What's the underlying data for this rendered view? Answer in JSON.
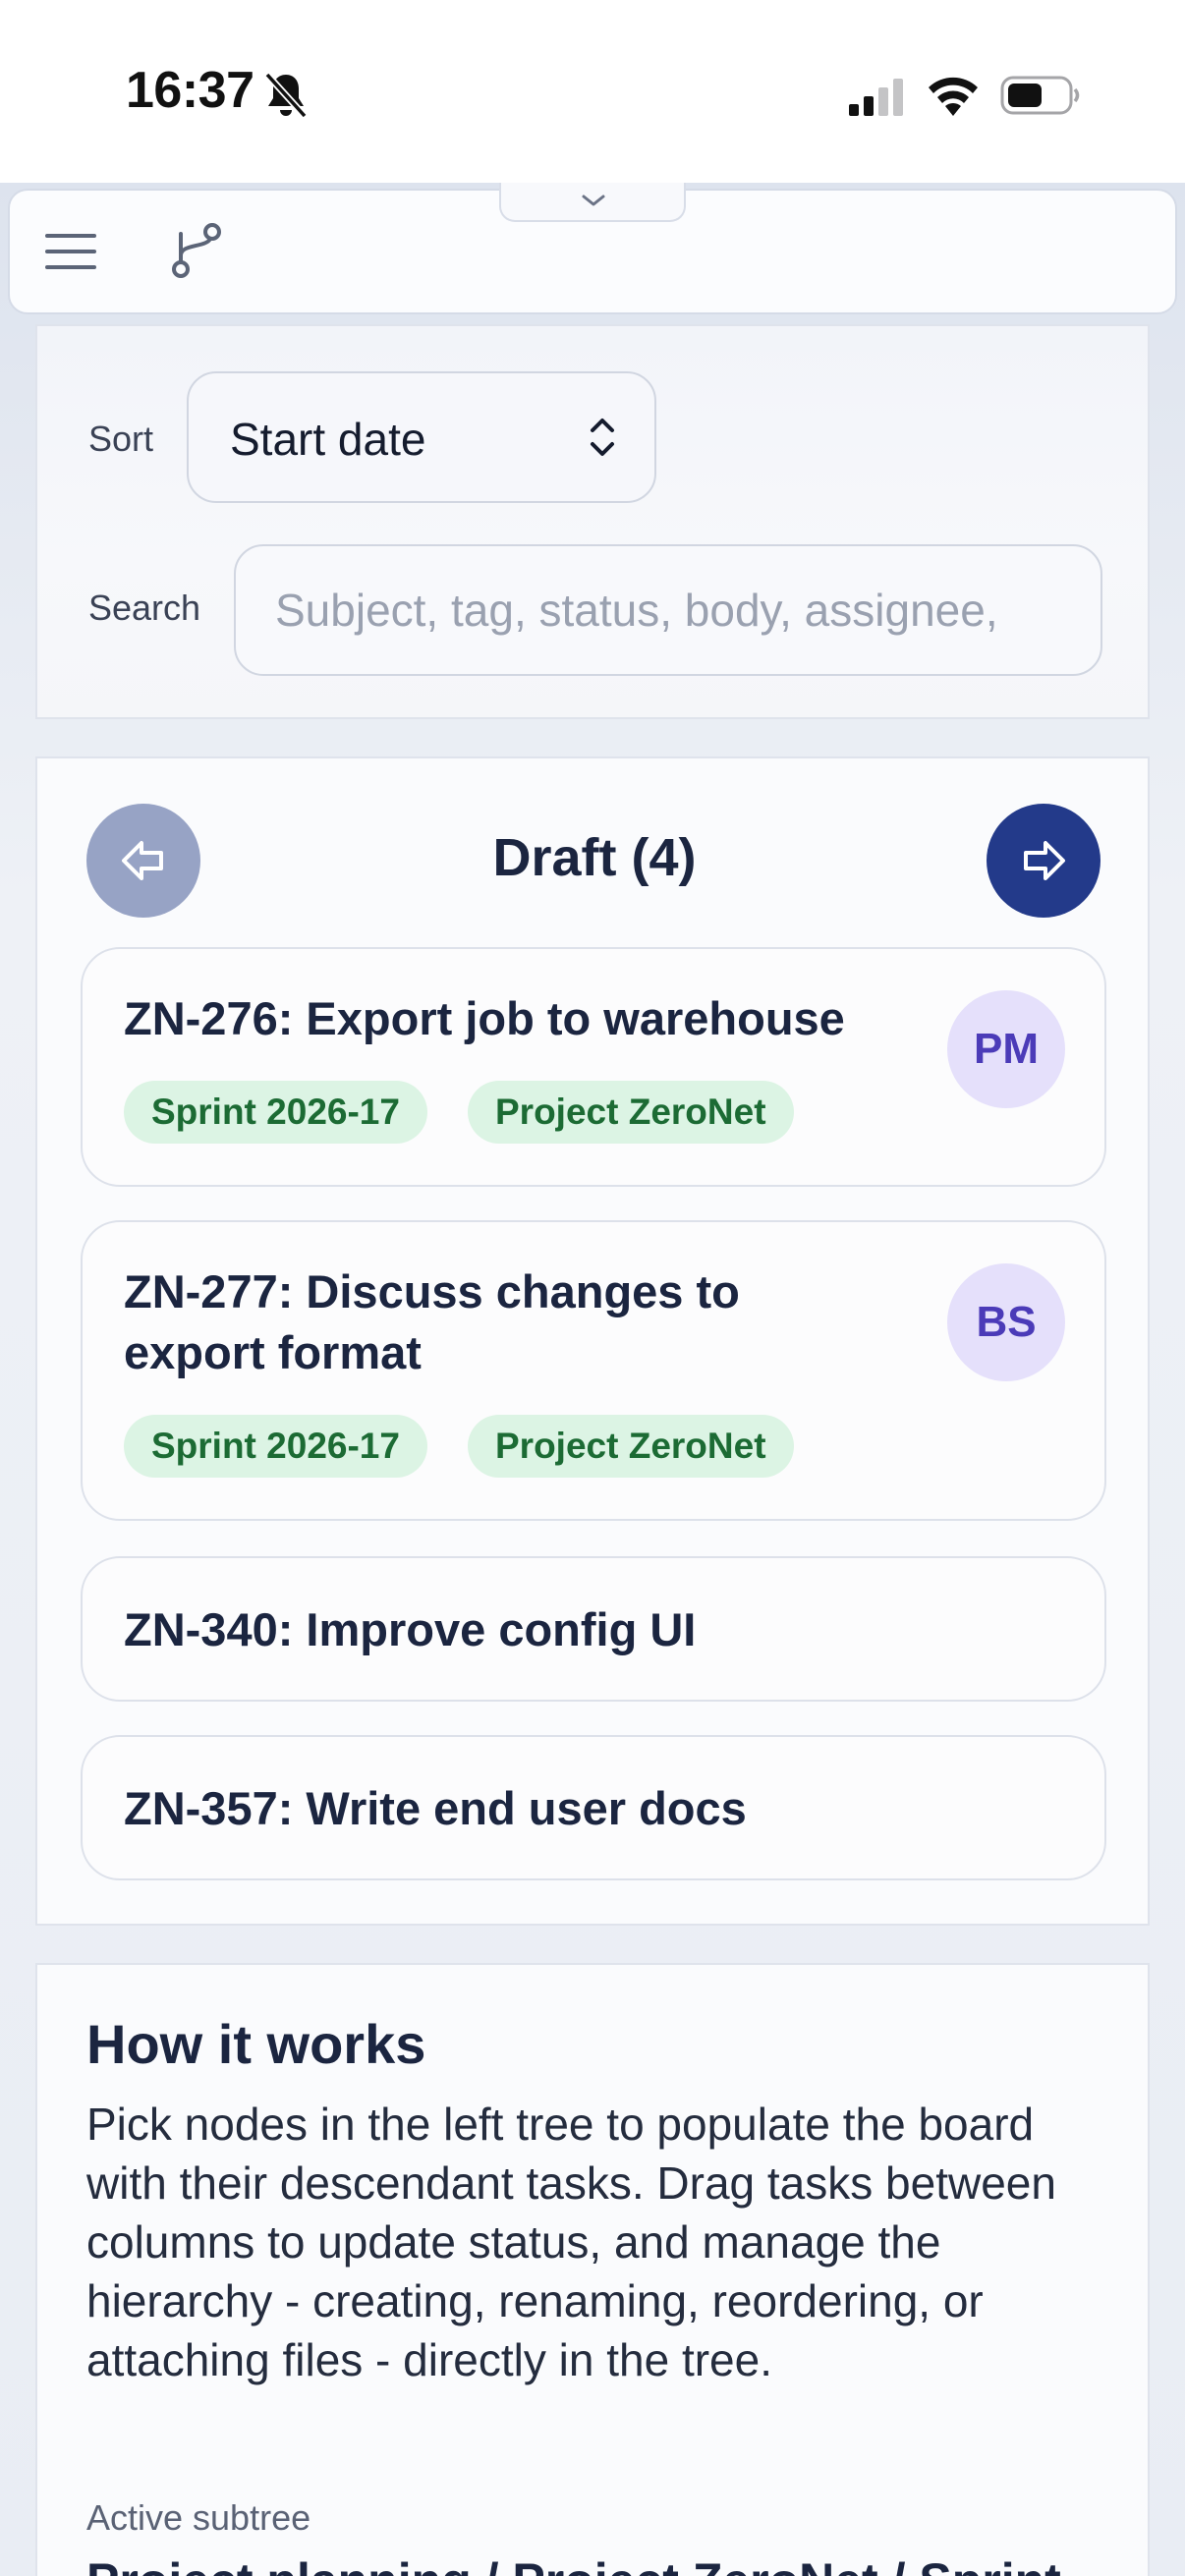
{
  "status_bar": {
    "time": "16:37",
    "icons": [
      "bell-slash-icon",
      "cellular-signal-icon",
      "wifi-icon",
      "battery-icon"
    ]
  },
  "toolbar": {
    "icons": [
      "hamburger-menu-icon",
      "branch-icon",
      "chevron-down-icon"
    ]
  },
  "filters": {
    "sort_label": "Sort",
    "sort_value": "Start date",
    "search_label": "Search",
    "search_placeholder": "Subject, tag, status, body, assignee,"
  },
  "column": {
    "title": "Draft (4)",
    "prev_icon": "arrow-left-icon",
    "next_icon": "arrow-right-icon",
    "cards": [
      {
        "title": "ZN-276: Export job to warehouse",
        "tags": [
          "Sprint 2026-17",
          "Project ZeroNet"
        ],
        "assignee": "PM"
      },
      {
        "title_line1": "ZN-277: Discuss changes to",
        "title_line2": "export format",
        "tags": [
          "Sprint 2026-17",
          "Project ZeroNet"
        ],
        "assignee": "BS"
      },
      {
        "title": "ZN-340: Improve config UI"
      },
      {
        "title": "ZN-357: Write end user docs"
      }
    ]
  },
  "info": {
    "heading": "How it works",
    "body": "Pick nodes in the left tree to populate the board with their descendant tasks. Drag tasks between columns to update status, and manage the hierarchy - creating, renaming, reordering, or attaching files - directly in the tree.",
    "subtree_label": "Active subtree",
    "subtree_path": "Project planning / Project ZeroNet / Sprint"
  },
  "colors": {
    "accent": "#233a8a",
    "accent_muted": "#97a3c5",
    "tag_bg": "#dcf4e4",
    "tag_text": "#1c6b34",
    "avatar_bg": "#e5e0fb",
    "avatar_text": "#4b3bb8"
  }
}
